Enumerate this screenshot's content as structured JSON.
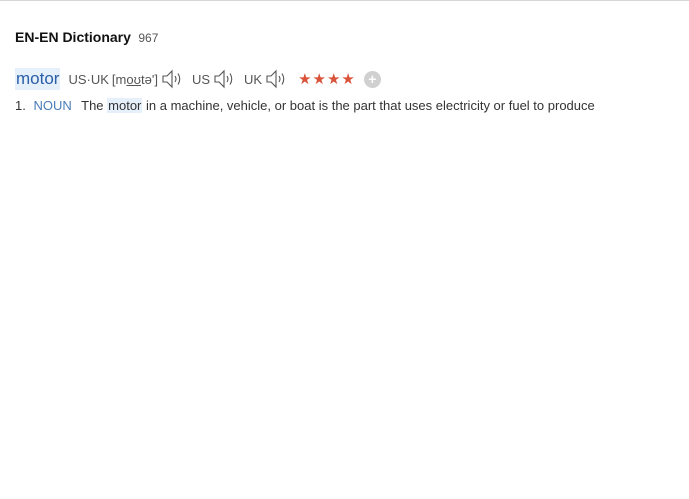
{
  "dictionary": {
    "title": "EN-EN Dictionary",
    "count": "967"
  },
  "entry": {
    "headword": "motor",
    "pron_us_uk_label": "US·UK",
    "phonetic_open": "[m",
    "phonetic_underlined": "oʊ",
    "phonetic_close": "tə']",
    "us_label": "US",
    "uk_label": "UK",
    "stars": "★★★★",
    "add_symbol": "+"
  },
  "definition": {
    "number": "1.",
    "pos": "NOUN",
    "text_before": "The ",
    "highlight": "motor",
    "text_after": " in a machine, vehicle, or boat is the part that uses electricity or fuel to produce"
  },
  "colors": {
    "accent": "#2a5ea8",
    "star": "#d9533b",
    "highlight_bg": "#e6f0fb"
  },
  "icons": [
    "speaker-icon",
    "star-icon",
    "add-icon"
  ]
}
